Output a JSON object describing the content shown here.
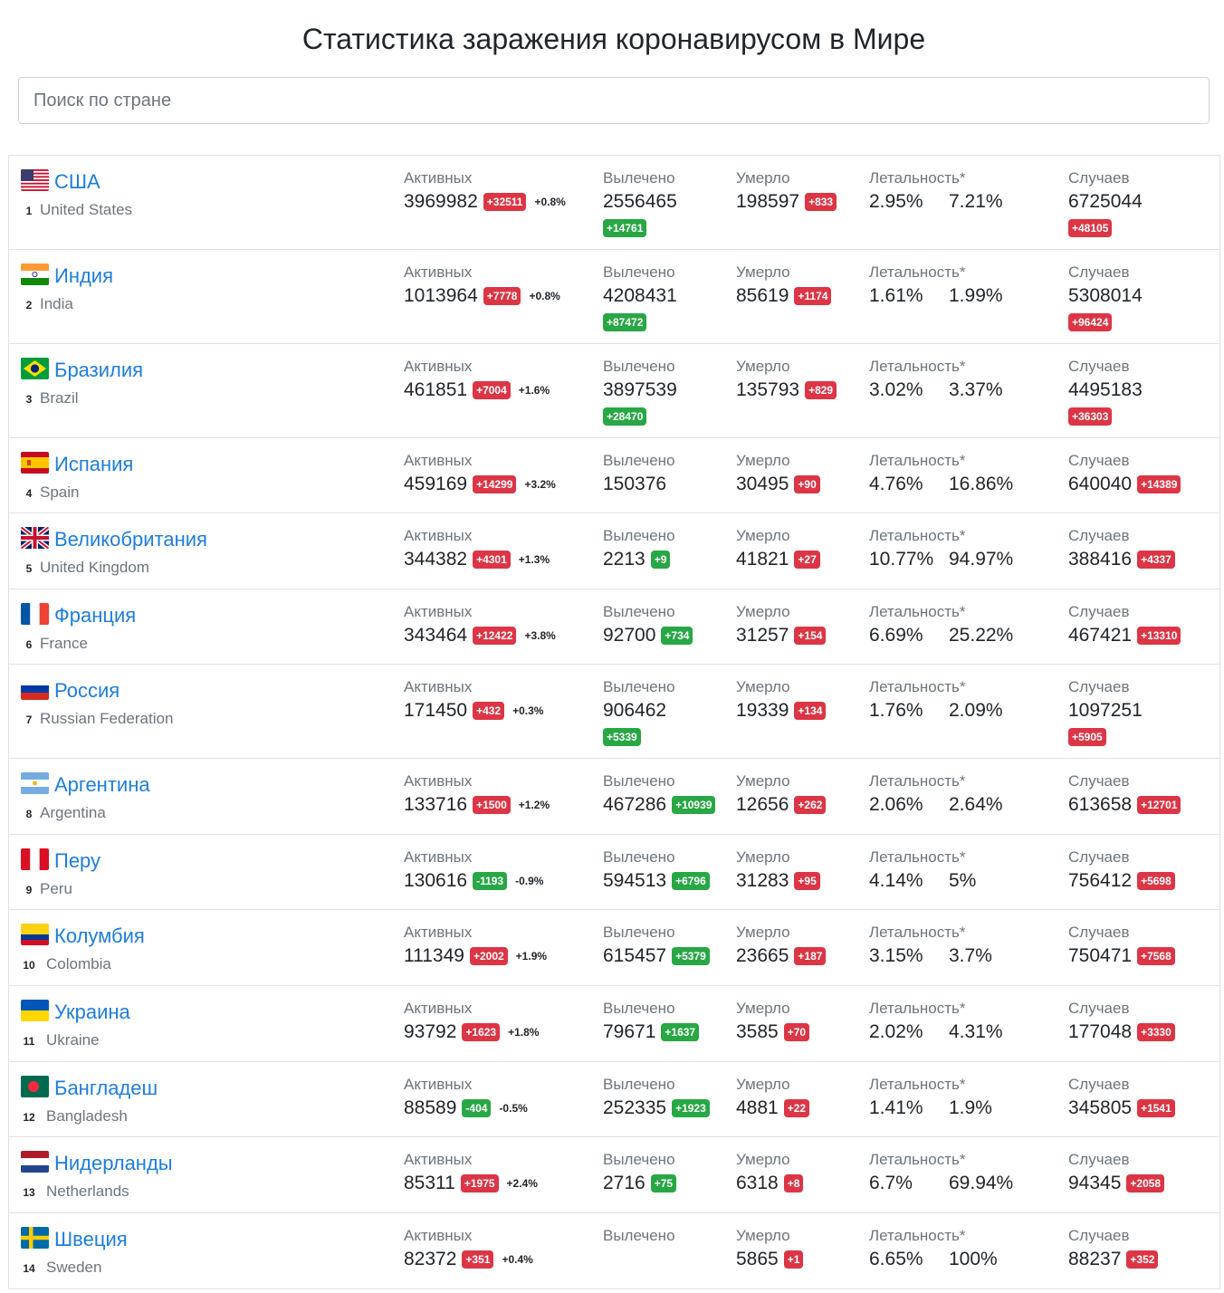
{
  "page": {
    "title": "Статистика заражения коронавирусом в Мире",
    "search_placeholder": "Поиск по стране"
  },
  "labels": {
    "active": "Активных",
    "recovered": "Вылечено",
    "deaths": "Умерло",
    "lethality": "Летальность*",
    "cases": "Случаев"
  },
  "colors": {
    "link": "#1e7ddb",
    "badge_red": "#dc3545",
    "badge_green": "#28a745"
  },
  "countries": [
    {
      "rank": "1",
      "name_ru": "США",
      "name_en": "United States",
      "flag": "us",
      "active": "3969982",
      "active_delta": "+32511",
      "active_delta_color": "red",
      "active_pct": "+0.8%",
      "recovered": "2556465",
      "recovered_delta": "+14761",
      "deaths": "198597",
      "deaths_delta": "+833",
      "leth1": "2.95%",
      "leth2": "7.21%",
      "cases": "6725044",
      "cases_delta": "+48105"
    },
    {
      "rank": "2",
      "name_ru": "Индия",
      "name_en": "India",
      "flag": "in",
      "active": "1013964",
      "active_delta": "+7778",
      "active_delta_color": "red",
      "active_pct": "+0.8%",
      "recovered": "4208431",
      "recovered_delta": "+87472",
      "deaths": "85619",
      "deaths_delta": "+1174",
      "leth1": "1.61%",
      "leth2": "1.99%",
      "cases": "5308014",
      "cases_delta": "+96424"
    },
    {
      "rank": "3",
      "name_ru": "Бразилия",
      "name_en": "Brazil",
      "flag": "br",
      "active": "461851",
      "active_delta": "+7004",
      "active_delta_color": "red",
      "active_pct": "+1.6%",
      "recovered": "3897539",
      "recovered_delta": "+28470",
      "deaths": "135793",
      "deaths_delta": "+829",
      "leth1": "3.02%",
      "leth2": "3.37%",
      "cases": "4495183",
      "cases_delta": "+36303"
    },
    {
      "rank": "4",
      "name_ru": "Испания",
      "name_en": "Spain",
      "flag": "es",
      "active": "459169",
      "active_delta": "+14299",
      "active_delta_color": "red",
      "active_pct": "+3.2%",
      "recovered": "150376",
      "recovered_delta": "",
      "deaths": "30495",
      "deaths_delta": "+90",
      "leth1": "4.76%",
      "leth2": "16.86%",
      "cases": "640040",
      "cases_delta": "+14389"
    },
    {
      "rank": "5",
      "name_ru": "Великобритания",
      "name_en": "United Kingdom",
      "flag": "gb",
      "active": "344382",
      "active_delta": "+4301",
      "active_delta_color": "red",
      "active_pct": "+1.3%",
      "recovered": "2213",
      "recovered_delta": "+9",
      "deaths": "41821",
      "deaths_delta": "+27",
      "leth1": "10.77%",
      "leth2": "94.97%",
      "cases": "388416",
      "cases_delta": "+4337"
    },
    {
      "rank": "6",
      "name_ru": "Франция",
      "name_en": "France",
      "flag": "fr",
      "active": "343464",
      "active_delta": "+12422",
      "active_delta_color": "red",
      "active_pct": "+3.8%",
      "recovered": "92700",
      "recovered_delta": "+734",
      "deaths": "31257",
      "deaths_delta": "+154",
      "leth1": "6.69%",
      "leth2": "25.22%",
      "cases": "467421",
      "cases_delta": "+13310"
    },
    {
      "rank": "7",
      "name_ru": "Россия",
      "name_en": "Russian Federation",
      "flag": "ru",
      "active": "171450",
      "active_delta": "+432",
      "active_delta_color": "red",
      "active_pct": "+0.3%",
      "recovered": "906462",
      "recovered_delta": "+5339",
      "deaths": "19339",
      "deaths_delta": "+134",
      "leth1": "1.76%",
      "leth2": "2.09%",
      "cases": "1097251",
      "cases_delta": "+5905"
    },
    {
      "rank": "8",
      "name_ru": "Аргентина",
      "name_en": "Argentina",
      "flag": "ar",
      "active": "133716",
      "active_delta": "+1500",
      "active_delta_color": "red",
      "active_pct": "+1.2%",
      "recovered": "467286",
      "recovered_delta": "+10939",
      "deaths": "12656",
      "deaths_delta": "+262",
      "leth1": "2.06%",
      "leth2": "2.64%",
      "cases": "613658",
      "cases_delta": "+12701"
    },
    {
      "rank": "9",
      "name_ru": "Перу",
      "name_en": "Peru",
      "flag": "pe",
      "active": "130616",
      "active_delta": "-1193",
      "active_delta_color": "green",
      "active_pct": "-0.9%",
      "recovered": "594513",
      "recovered_delta": "+6796",
      "deaths": "31283",
      "deaths_delta": "+95",
      "leth1": "4.14%",
      "leth2": "5%",
      "cases": "756412",
      "cases_delta": "+5698"
    },
    {
      "rank": "10",
      "name_ru": "Колумбия",
      "name_en": "Colombia",
      "flag": "co",
      "active": "111349",
      "active_delta": "+2002",
      "active_delta_color": "red",
      "active_pct": "+1.9%",
      "recovered": "615457",
      "recovered_delta": "+5379",
      "deaths": "23665",
      "deaths_delta": "+187",
      "leth1": "3.15%",
      "leth2": "3.7%",
      "cases": "750471",
      "cases_delta": "+7568"
    },
    {
      "rank": "11",
      "name_ru": "Украина",
      "name_en": "Ukraine",
      "flag": "ua",
      "active": "93792",
      "active_delta": "+1623",
      "active_delta_color": "red",
      "active_pct": "+1.8%",
      "recovered": "79671",
      "recovered_delta": "+1637",
      "deaths": "3585",
      "deaths_delta": "+70",
      "leth1": "2.02%",
      "leth2": "4.31%",
      "cases": "177048",
      "cases_delta": "+3330"
    },
    {
      "rank": "12",
      "name_ru": "Бангладеш",
      "name_en": "Bangladesh",
      "flag": "bd",
      "active": "88589",
      "active_delta": "-404",
      "active_delta_color": "green",
      "active_pct": "-0.5%",
      "recovered": "252335",
      "recovered_delta": "+1923",
      "deaths": "4881",
      "deaths_delta": "+22",
      "leth1": "1.41%",
      "leth2": "1.9%",
      "cases": "345805",
      "cases_delta": "+1541"
    },
    {
      "rank": "13",
      "name_ru": "Нидерланды",
      "name_en": "Netherlands",
      "flag": "nl",
      "active": "85311",
      "active_delta": "+1975",
      "active_delta_color": "red",
      "active_pct": "+2.4%",
      "recovered": "2716",
      "recovered_delta": "+75",
      "deaths": "6318",
      "deaths_delta": "+8",
      "leth1": "6.7%",
      "leth2": "69.94%",
      "cases": "94345",
      "cases_delta": "+2058"
    },
    {
      "rank": "14",
      "name_ru": "Швеция",
      "name_en": "Sweden",
      "flag": "se",
      "active": "82372",
      "active_delta": "+351",
      "active_delta_color": "red",
      "active_pct": "+0.4%",
      "recovered": "",
      "recovered_delta": "",
      "deaths": "5865",
      "deaths_delta": "+1",
      "leth1": "6.65%",
      "leth2": "100%",
      "cases": "88237",
      "cases_delta": "+352"
    }
  ]
}
